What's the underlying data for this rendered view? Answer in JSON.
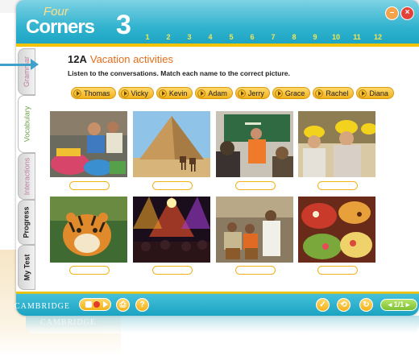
{
  "app": {
    "logo_top": "Four",
    "logo_main": "Corners",
    "logo_level": "3",
    "publisher": "CAMBRIDGE",
    "units": [
      "1",
      "2",
      "3",
      "4",
      "5",
      "6",
      "7",
      "8",
      "9",
      "10",
      "11",
      "12"
    ]
  },
  "sidebar": {
    "tabs": [
      {
        "label": "Grammar"
      },
      {
        "label": "Vocabulary"
      },
      {
        "label": "Interactions"
      },
      {
        "label": "Progress"
      },
      {
        "label": "My Test"
      }
    ]
  },
  "activity": {
    "code": "12A",
    "title": "Vacation activities",
    "instruction": "Listen to the conversations. Match each name to the correct picture.",
    "names": [
      "Thomas",
      "Vicky",
      "Kevin",
      "Adam",
      "Jerry",
      "Grace",
      "Rachel",
      "Diana"
    ]
  },
  "pictures": [
    {
      "subject": "outdoor market with colorful fabrics"
    },
    {
      "subject": "pyramid with camels"
    },
    {
      "subject": "classroom with teacher"
    },
    {
      "subject": "people in hard hats"
    },
    {
      "subject": "tiger"
    },
    {
      "subject": "concert with stage lights"
    },
    {
      "subject": "musicians and dancer"
    },
    {
      "subject": "colorful food platter"
    }
  ],
  "footer": {
    "pager": "1/1"
  },
  "colors": {
    "header": "#1aa3c2",
    "accent_yellow": "#f2c400",
    "title_orange": "#e36d1a",
    "pill": "#f2b21a"
  }
}
